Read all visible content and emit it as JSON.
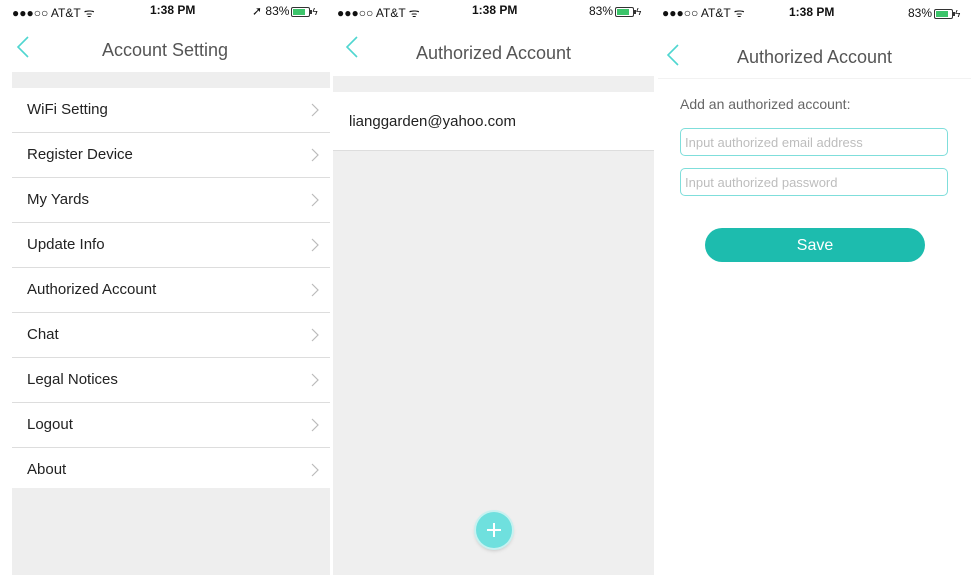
{
  "colors": {
    "accent": "#1dbcae",
    "back_arrow": "#4fd6d0",
    "battery": "#3cc46a"
  },
  "screens": [
    {
      "status": {
        "carrier": "●●●○○ AT&T ᯤ",
        "time": "1:38 PM",
        "battery": "➚ 83%"
      },
      "nav_title": "Account Setting",
      "menu_items": [
        {
          "label": "WiFi Setting"
        },
        {
          "label": "Register Device"
        },
        {
          "label": "My Yards"
        },
        {
          "label": "Update Info"
        },
        {
          "label": "Authorized Account"
        },
        {
          "label": "Chat"
        },
        {
          "label": "Legal Notices"
        },
        {
          "label": "Logout"
        },
        {
          "label": "About"
        }
      ]
    },
    {
      "status": {
        "carrier": "●●●○○ AT&T ᯤ",
        "time": "1:38 PM",
        "battery": "83%"
      },
      "nav_title": "Authorized Account",
      "accounts": [
        {
          "email": "lianggarden@yahoo.com"
        }
      ],
      "add_icon": "plus-circle-icon"
    },
    {
      "status": {
        "carrier": "●●●○○ AT&T ᯤ",
        "time": "1:38 PM",
        "battery": "83%"
      },
      "nav_title": "Authorized Account",
      "form_title": "Add an authorized account:",
      "email_placeholder": "Input authorized email address",
      "password_placeholder": "Input authorized password",
      "save_label": "Save"
    }
  ]
}
